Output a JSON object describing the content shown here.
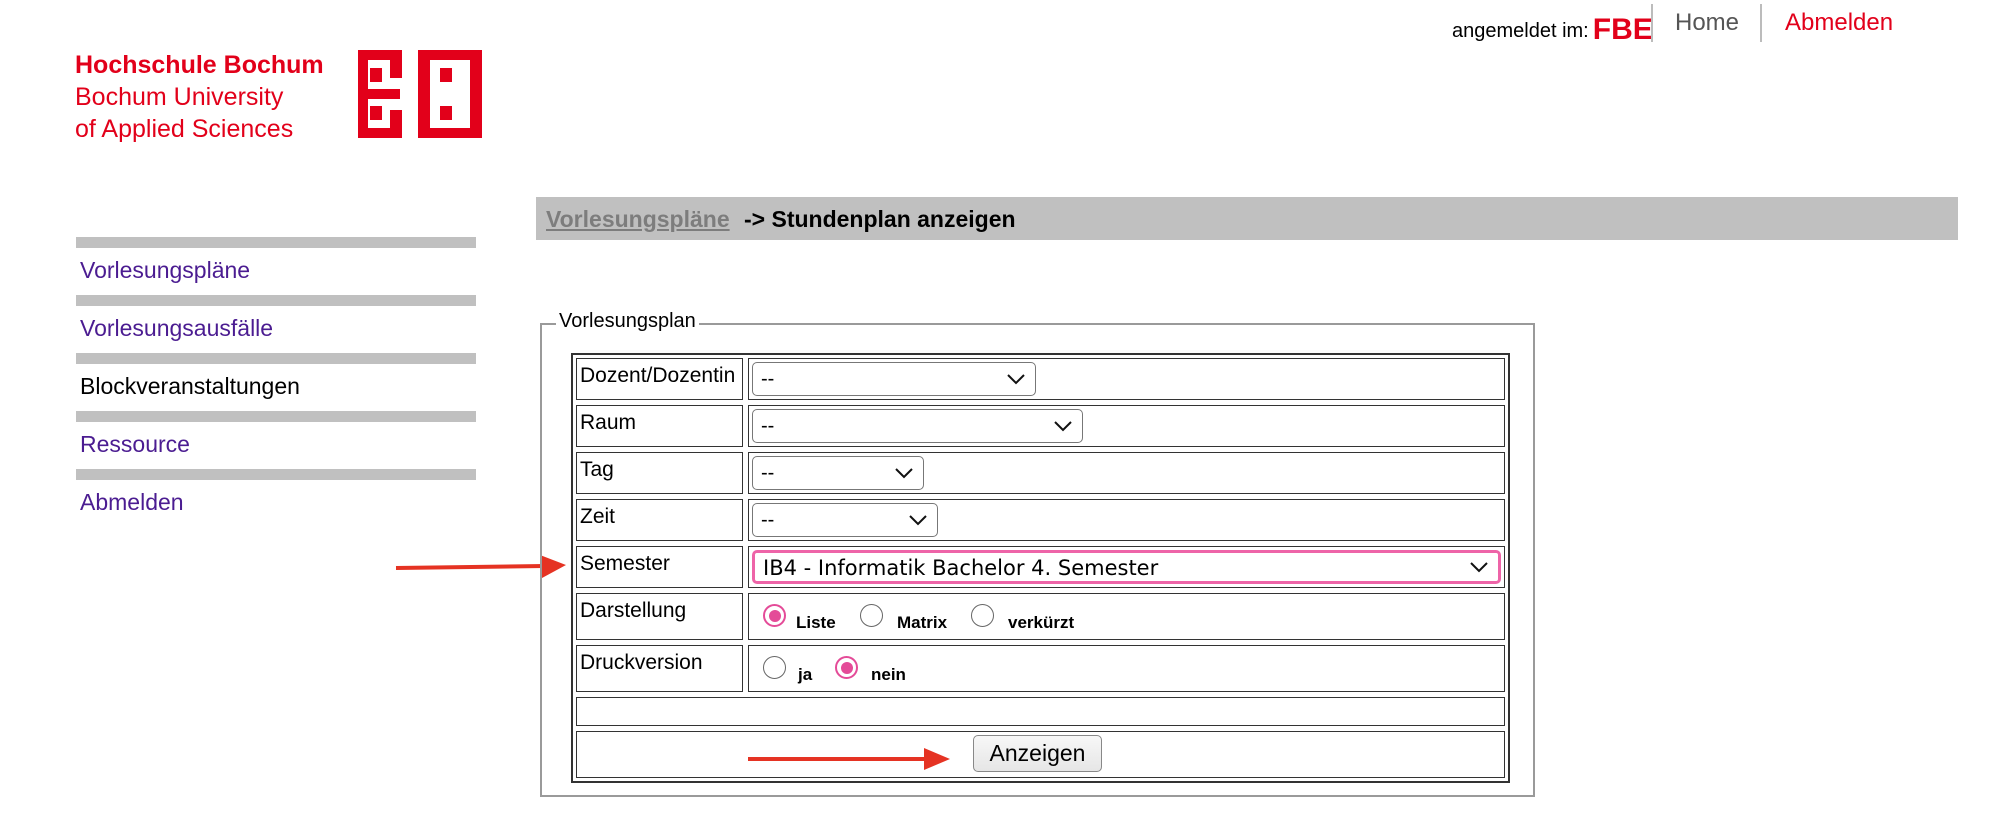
{
  "topbar": {
    "logged_in_label": "angemeldet im:",
    "department": "FBE",
    "home": "Home",
    "logout": "Abmelden"
  },
  "logo": {
    "line1": "Hochschule Bochum",
    "line2": "Bochum University",
    "line3": "of Applied Sciences",
    "mark": "BO"
  },
  "sidebar": {
    "items": [
      {
        "label": "Vorlesungspläne"
      },
      {
        "label": "Vorlesungsausfälle"
      },
      {
        "label": "Blockveranstaltungen"
      },
      {
        "label": "Ressource"
      },
      {
        "label": "Abmelden"
      }
    ]
  },
  "breadcrumb": {
    "link": "Vorlesungspläne ",
    "current": "-> Stundenplan anzeigen"
  },
  "form": {
    "legend": "Vorlesungsplan",
    "rows": {
      "dozent": {
        "label": "Dozent/Dozentin",
        "value": "--"
      },
      "raum": {
        "label": "Raum",
        "value": "--"
      },
      "tag": {
        "label": "Tag",
        "value": "--"
      },
      "zeit": {
        "label": "Zeit",
        "value": "--"
      },
      "semester": {
        "label": "Semester",
        "value": "IB4 - Informatik Bachelor 4. Semester"
      },
      "darstellung": {
        "label": "Darstellung",
        "options": [
          "Liste",
          "Matrix",
          "verkürzt"
        ],
        "selected": "Liste"
      },
      "druck": {
        "label": "Druckversion",
        "options": [
          "ja",
          "nein"
        ],
        "selected": "nein"
      }
    },
    "submit": "Anzeigen"
  },
  "colors": {
    "brand": "#e2001a",
    "link": "#4b1c91",
    "highlight": "#ee64a8",
    "annotation_arrow": "#e53323"
  }
}
